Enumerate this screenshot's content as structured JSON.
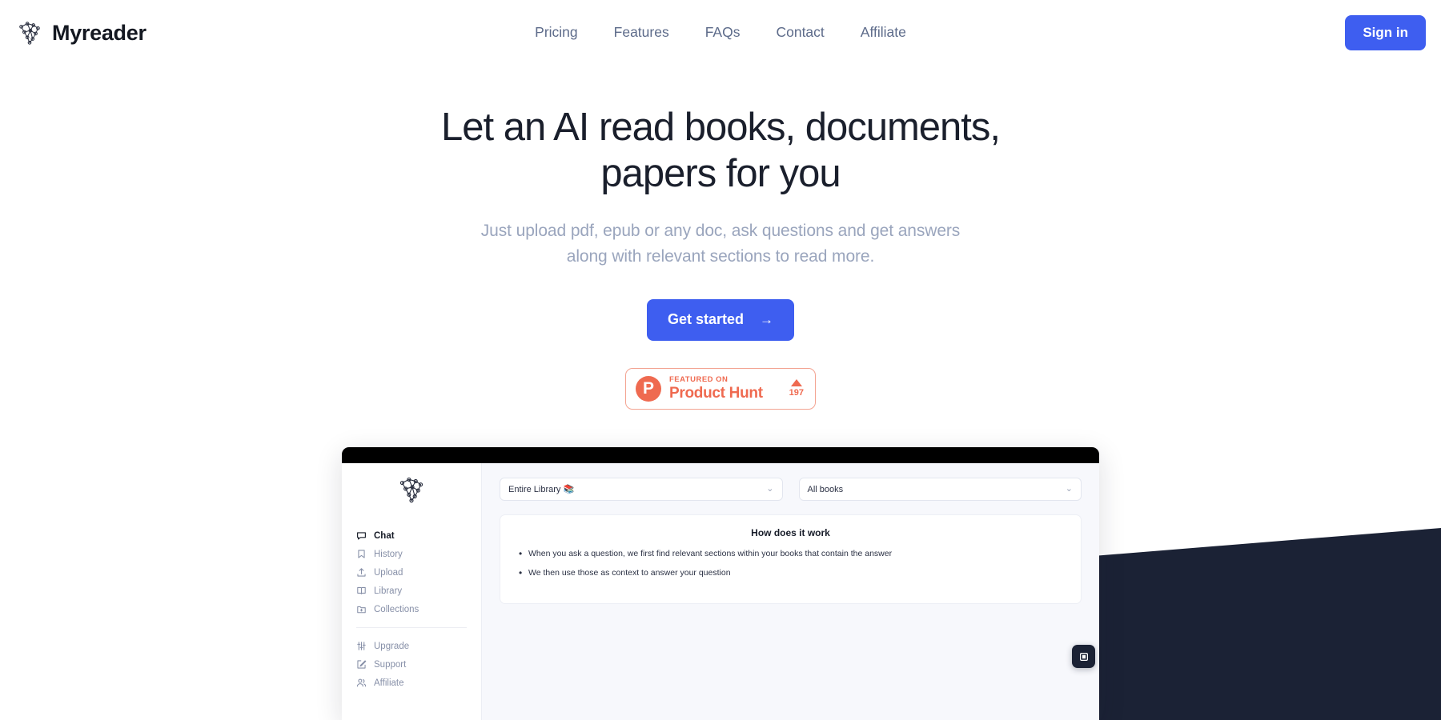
{
  "brand": {
    "name": "Myreader",
    "logo_icon": "network-graph-icon"
  },
  "nav": {
    "links": [
      {
        "label": "Pricing"
      },
      {
        "label": "Features"
      },
      {
        "label": "FAQs"
      },
      {
        "label": "Contact"
      },
      {
        "label": "Affiliate"
      }
    ],
    "signin_label": "Sign in"
  },
  "hero": {
    "headline": "Let an AI read books, documents, papers for you",
    "subheadline": "Just upload pdf, epub or any doc, ask questions and get answers along with relevant sections to read more.",
    "cta_label": "Get started",
    "cta_arrow": "→"
  },
  "product_hunt": {
    "logo_letter": "P",
    "kicker": "FEATURED ON",
    "title": "Product Hunt",
    "upvote_count": "197",
    "upvote_icon": "triangle-up-icon",
    "accent_color": "#ef6a50"
  },
  "app_preview": {
    "sidebar": {
      "logo_icon": "network-graph-icon",
      "primary_items": [
        {
          "label": "Chat",
          "icon": "chat-bubble-icon",
          "active": true
        },
        {
          "label": "History",
          "icon": "bookmark-icon",
          "active": false
        },
        {
          "label": "Upload",
          "icon": "upload-icon",
          "active": false
        },
        {
          "label": "Library",
          "icon": "book-open-icon",
          "active": false
        },
        {
          "label": "Collections",
          "icon": "folder-plus-icon",
          "active": false
        }
      ],
      "secondary_items": [
        {
          "label": "Upgrade",
          "icon": "sliders-icon"
        },
        {
          "label": "Support",
          "icon": "edit-square-icon"
        },
        {
          "label": "Affiliate",
          "icon": "users-icon"
        }
      ]
    },
    "filters": [
      {
        "name": "library-scope",
        "value": "Entire Library 📚",
        "chevron": "⌄"
      },
      {
        "name": "book-filter",
        "value": "All books",
        "chevron": "⌄"
      }
    ],
    "info_card": {
      "title": "How does it work",
      "bullets": [
        "When you ask a question, we first find relevant sections within your books that contain the answer",
        "We then use those as context to answer your question"
      ]
    },
    "fab_icon": "book-square-icon"
  },
  "theme": {
    "primary_blue": "#3e5ef0",
    "dark_navy": "#1b2235",
    "nav_text": "#5d6b8a",
    "muted_text": "#9aa5bd"
  }
}
